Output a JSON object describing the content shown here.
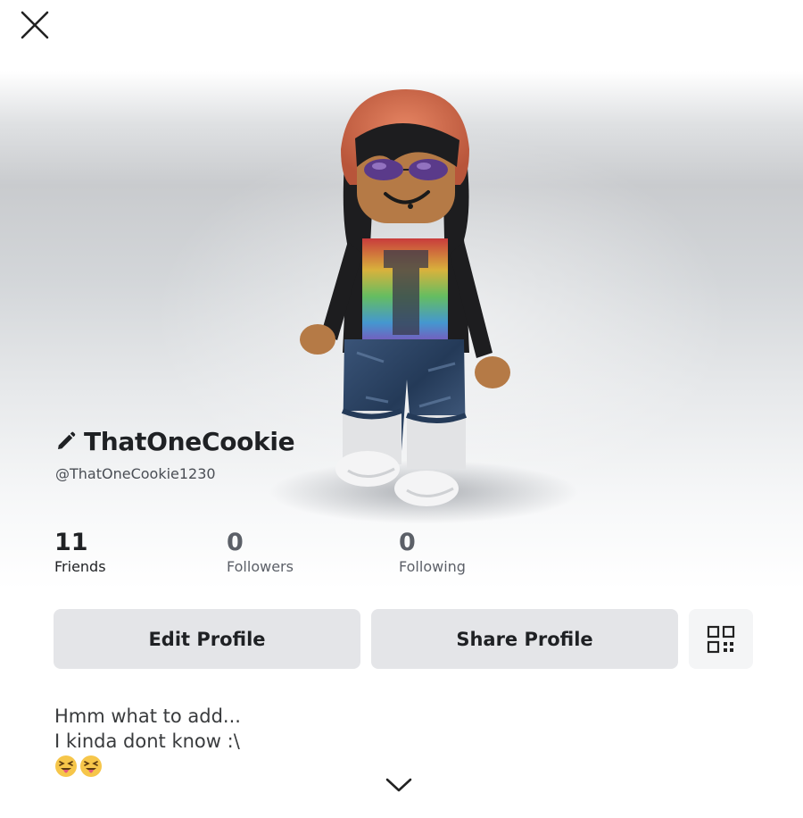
{
  "header": {
    "close_icon": "close-icon"
  },
  "profile": {
    "edit_icon": "pencil-icon",
    "display_name": "ThatOneCookie",
    "username": "@ThatOneCookie1230"
  },
  "stats": [
    {
      "value": "11",
      "label": "Friends",
      "color": "#1f2124"
    },
    {
      "value": "0",
      "label": "Followers",
      "color": "#5c6068"
    },
    {
      "value": "0",
      "label": "Following",
      "color": "#5c6068"
    }
  ],
  "actions": {
    "edit_label": "Edit Profile",
    "share_label": "Share Profile",
    "qr_icon": "qr-code-icon"
  },
  "bio": {
    "line1": "Hmm what to add...",
    "line2": "I kinda dont know :\\",
    "emoji": [
      "squinting-face-with-tongue",
      "squinting-face-with-tongue"
    ]
  },
  "footer": {
    "expand_icon": "chevron-down-icon"
  },
  "colors": {
    "text_primary": "#1f2124",
    "text_secondary": "#5c6068",
    "button_bg": "#e4e5e8",
    "qr_button_bg": "#f4f5f6"
  }
}
